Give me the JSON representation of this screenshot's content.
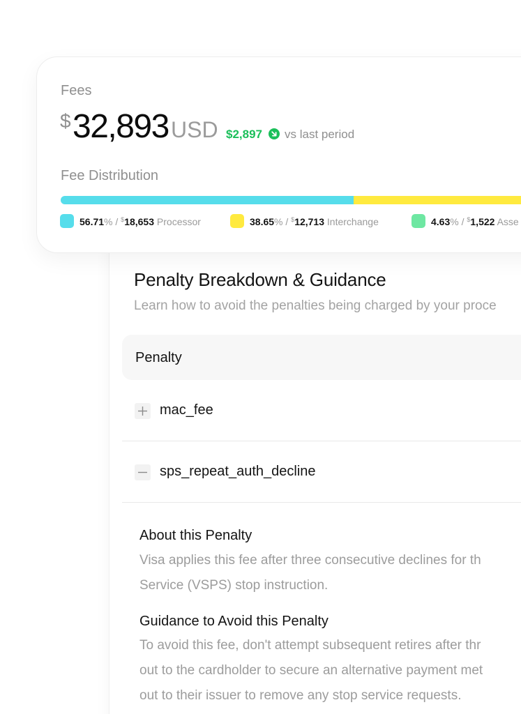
{
  "fees": {
    "label": "Fees",
    "currency_symbol": "$",
    "total": "32,893",
    "unit": "USD",
    "delta_amount": "$2,897",
    "delta_text": "vs last period",
    "distribution_label": "Fee Distribution",
    "distribution": [
      {
        "percent": "56.71",
        "value": "18,653",
        "category": "Processor",
        "color": "#56DDEB",
        "fraction": 0.5671
      },
      {
        "percent": "38.65",
        "value": "12,713",
        "category": "Interchange",
        "color": "#FFEA3F",
        "fraction": 0.3865
      },
      {
        "percent": "4.63",
        "value": "1,522",
        "category": "Asse",
        "color": "#6EE7A2",
        "fraction": 0.0463
      }
    ]
  },
  "penalties": {
    "title": "Penalty Breakdown & Guidance",
    "subtitle": "Learn how to avoid the penalties being charged by your proce",
    "column_header": "Penalty",
    "rows": [
      {
        "name": "mac_fee",
        "expanded": false
      },
      {
        "name": "sps_repeat_auth_decline",
        "expanded": true
      }
    ],
    "detail": {
      "about_heading": "About this Penalty",
      "about_line1": "Visa applies this fee after three consecutive declines for th",
      "about_line2": "Service (VSPS) stop instruction.",
      "guidance_heading": "Guidance to Avoid this Penalty",
      "guidance_line1": "To avoid this fee, don't attempt subsequent retires after thr",
      "guidance_line2": "out to the cardholder to secure an alternative payment met",
      "guidance_line3": "out to their issuer to remove any stop service requests."
    }
  },
  "colors": {
    "positive": "#1BBF5A",
    "muted_text": "#9A9A9A"
  }
}
